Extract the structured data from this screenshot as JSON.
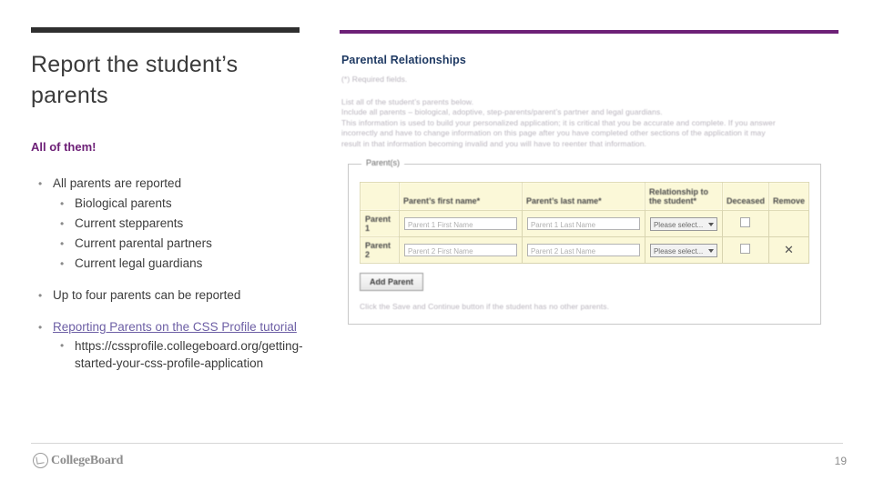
{
  "slide": {
    "title": "Report the student’s parents",
    "subhead": "All of them!",
    "page_number": "19",
    "accent_color": "#6d2077",
    "logo_text": "CollegeBoard"
  },
  "bullets": [
    {
      "text": "All parents are reported",
      "children": [
        "Biological parents",
        "Current stepparents",
        "Current parental partners",
        "Current legal guardians"
      ]
    },
    {
      "text": "Up to four parents can be reported",
      "children": []
    },
    {
      "text": "Reporting Parents on the CSS Profile tutorial",
      "link": true,
      "children": [
        "https://cssprofile.collegeboard.org/getting-started-your-css-profile-application"
      ]
    }
  ],
  "form": {
    "title": "Parental Relationships",
    "required_note": "(*) Required fields.",
    "intro_lines": [
      "List all of the student’s parents below.",
      "Include all parents – biological, adoptive, step-parents/parent’s partner and legal guardians.",
      "This information is used to build your personalized application; it is critical that you be accurate and complete. If you answer",
      "incorrectly and have to change information on this page after you have completed other sections of the application it may",
      "result in that information becoming invalid and you will have to reenter that information."
    ],
    "panel_legend": "Parent(s)",
    "table": {
      "headers": [
        "",
        "Parent’s first name*",
        "Parent’s last name*",
        "Relationship to the student*",
        "Deceased",
        "Remove"
      ],
      "rows": [
        {
          "label": "Parent 1",
          "first_name_placeholder": "Parent 1 First Name",
          "last_name_placeholder": "Parent 1 Last Name",
          "relationship_value": "Please select...",
          "deceased_checked": false,
          "remove": ""
        },
        {
          "label": "Parent 2",
          "first_name_placeholder": "Parent 2 First Name",
          "last_name_placeholder": "Parent 2 Last Name",
          "relationship_value": "Please select...",
          "deceased_checked": false,
          "remove": "✕"
        }
      ]
    },
    "add_parent_label": "Add Parent",
    "footer_note": "Click the Save and Continue button if the student has no other parents."
  }
}
